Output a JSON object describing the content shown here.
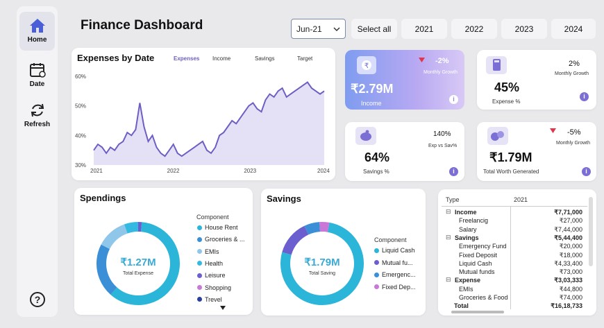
{
  "sidebar": {
    "items": [
      {
        "label": "Home"
      },
      {
        "label": "Date"
      },
      {
        "label": "Refresh"
      }
    ]
  },
  "header": {
    "title": "Finance Dashboard",
    "month_value": "Jun-21",
    "select_all": "Select all",
    "years": [
      "2021",
      "2022",
      "2023",
      "2024"
    ]
  },
  "expenses_chart": {
    "title": "Expenses by Date",
    "tabs": [
      "Expenses",
      "Income",
      "Savings",
      "Target"
    ]
  },
  "chart_data": {
    "type": "area",
    "title": "Expenses by Date",
    "x_ticks": [
      "2021",
      "2022",
      "2023",
      "2024"
    ],
    "y_ticks": [
      "60%",
      "50%",
      "40%",
      "30%"
    ],
    "ylim": [
      30,
      60
    ],
    "series": [
      {
        "name": "Expenses",
        "values": [
          35,
          37,
          36,
          34,
          36,
          35,
          37,
          38,
          41,
          40,
          42,
          51,
          43,
          38,
          40,
          36,
          34,
          33,
          35,
          37,
          34,
          33,
          34,
          35,
          36,
          37,
          38,
          35,
          34,
          36,
          40,
          41,
          43,
          45,
          44,
          46,
          48,
          50,
          51,
          49,
          48,
          52,
          54,
          53,
          55,
          56,
          53,
          54,
          55,
          56,
          57,
          58,
          56,
          55,
          54,
          55
        ]
      }
    ],
    "grid": false,
    "color": "#6b5fc4"
  },
  "kpis": {
    "income": {
      "value": "₹2.79M",
      "label": "Income",
      "change": "-2%",
      "change_label": "Monthly Growth"
    },
    "expense": {
      "value": "45%",
      "label": "Expense %",
      "change": "2%",
      "change_label": "Monthly Growth"
    },
    "savings": {
      "value": "64%",
      "label": "Savings %",
      "change": "140%",
      "change_label": "Exp vs Sav%"
    },
    "worth": {
      "value": "₹1.79M",
      "label": "Total Worth Generated",
      "change": "-5%",
      "change_label": "Monthly Growth"
    }
  },
  "spendings": {
    "title": "Spendings",
    "center_value": "₹1.27M",
    "center_label": "Total Expense",
    "legend_title": "Component",
    "items": [
      {
        "label": "House Rent",
        "color": "#2bb5d9"
      },
      {
        "label": "Groceries & ...",
        "color": "#3a8fd6"
      },
      {
        "label": "EMIs",
        "color": "#8fc7ea"
      },
      {
        "label": "Health",
        "color": "#34b9e0"
      },
      {
        "label": "Leisure",
        "color": "#6b5fd0"
      },
      {
        "label": "Shopping",
        "color": "#c978d8"
      },
      {
        "label": "Trevel",
        "color": "#2b3fa0"
      }
    ]
  },
  "savings_donut": {
    "title": "Savings",
    "center_value": "₹1.79M",
    "center_label": "Total Saving",
    "legend_title": "Component",
    "items": [
      {
        "label": "Liquid Cash",
        "color": "#2bb5d9"
      },
      {
        "label": "Mutual fu...",
        "color": "#6b5fd0"
      },
      {
        "label": "Emergenc...",
        "color": "#3a8fd6"
      },
      {
        "label": "Fixed Dep...",
        "color": "#c978d8"
      }
    ]
  },
  "table": {
    "header_type": "Type",
    "header_year": "2021",
    "rows": [
      {
        "label": "Income",
        "value": "₹7,71,000",
        "level": 0
      },
      {
        "label": "Freelancig",
        "value": "₹27,000",
        "level": 1
      },
      {
        "label": "Salary",
        "value": "₹7,44,000",
        "level": 1
      },
      {
        "label": "Savings",
        "value": "₹5,44,400",
        "level": 0
      },
      {
        "label": "Emergency Fund",
        "value": "₹20,000",
        "level": 1
      },
      {
        "label": "Fixed Deposit",
        "value": "₹18,000",
        "level": 1
      },
      {
        "label": "Liquid Cash",
        "value": "₹4,33,400",
        "level": 1
      },
      {
        "label": "Mutual funds",
        "value": "₹73,000",
        "level": 1
      },
      {
        "label": "Expense",
        "value": "₹3,03,333",
        "level": 0
      },
      {
        "label": "EMIs",
        "value": "₹44,800",
        "level": 1
      },
      {
        "label": "Groceries & Food",
        "value": "₹74,000",
        "level": 1
      },
      {
        "label": "Total",
        "value": "₹16,18,733",
        "level": 2
      }
    ]
  }
}
